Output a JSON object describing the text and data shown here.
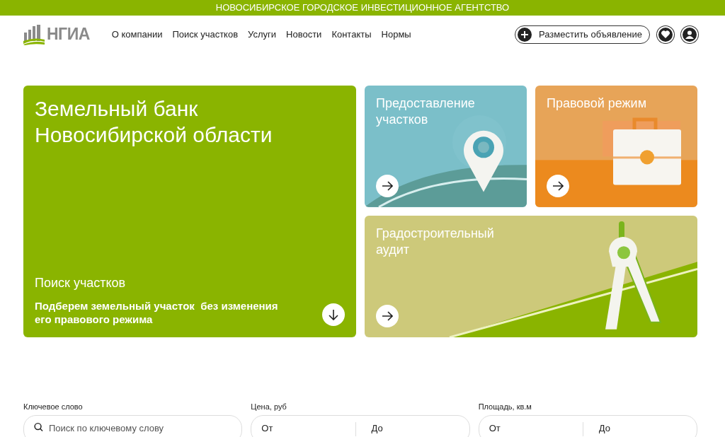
{
  "top_banner": "НОВОСИБИРСКОЕ ГОРОДСКОЕ ИНВЕСТИЦИОННОЕ АГЕНТСТВО",
  "logo": {
    "text": "НГИА"
  },
  "nav": [
    "О компании",
    "Поиск участков",
    "Услуги",
    "Новости",
    "Контакты",
    "Нормы"
  ],
  "post_button": "Разместить объявление",
  "hero": {
    "title": "Земельный банк Новосибирской области",
    "subtitle": "Поиск участков",
    "description": "Подберем земельный участок  без изменения его правового режима"
  },
  "cards": [
    {
      "kind": "pin",
      "title": "Предоставление участков"
    },
    {
      "kind": "briefcase",
      "title": "Правовой режим"
    },
    {
      "kind": "compass",
      "title": "Градостроительный аудит"
    }
  ],
  "filters": [
    {
      "kind": "search",
      "label": "Ключевое слово",
      "placeholder": "Поиск по ключевому слову"
    },
    {
      "kind": "range",
      "label": "Цена, руб",
      "from_placeholder": "От",
      "to_placeholder": "До"
    },
    {
      "kind": "range",
      "label": "Площадь, кв.м",
      "from_placeholder": "От",
      "to_placeholder": "До"
    }
  ]
}
